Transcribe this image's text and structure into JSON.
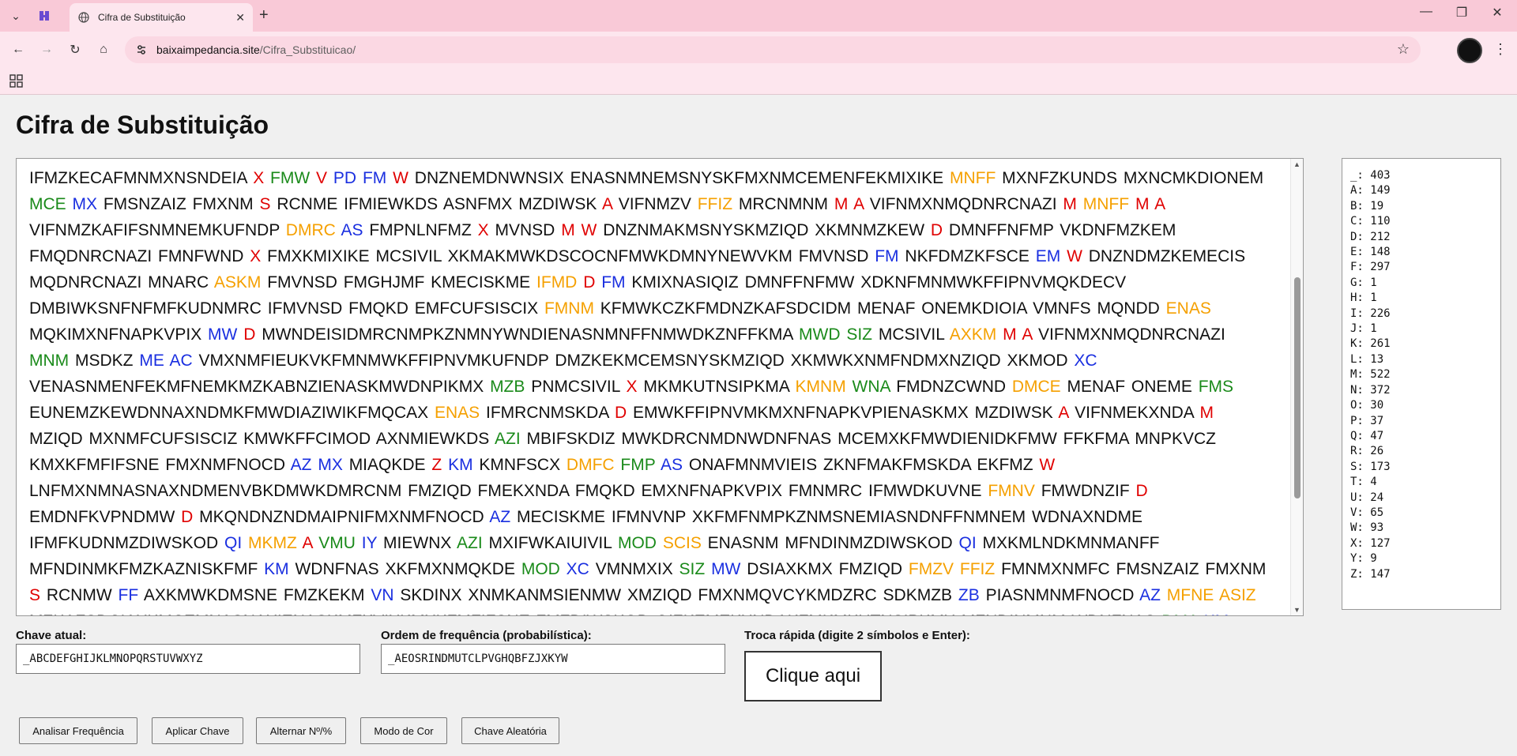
{
  "browser": {
    "tab_title": "Cifra de Substituição",
    "url_host": "baixaimpedancia.site",
    "url_path": "/Cifra_Substituicao/"
  },
  "page": {
    "title": "Cifra de Substituição"
  },
  "cipher_lines": [
    [
      [
        "n",
        "IFMZKECAFMNMXNSNDEIA "
      ],
      [
        "r",
        "X"
      ],
      [
        "n",
        " "
      ],
      [
        "g",
        "FMW"
      ],
      [
        "n",
        " "
      ],
      [
        "r",
        "V"
      ],
      [
        "n",
        " "
      ],
      [
        "b",
        "PD"
      ],
      [
        "n",
        " "
      ],
      [
        "b",
        "FM"
      ],
      [
        "n",
        " "
      ],
      [
        "r",
        "W"
      ],
      [
        "n",
        " DNZNEMDNWNSIX ENASNMNEMSNYSKFMXNMCEMENFEKMIXIKE "
      ],
      [
        "o",
        "MNFF"
      ],
      [
        "n",
        " MXNFZKUNDS MXNCMKDIONEM"
      ]
    ],
    [
      [
        "g",
        "MCE"
      ],
      [
        "n",
        " "
      ],
      [
        "b",
        "MX"
      ],
      [
        "n",
        " FMSNZAIZ FMXNM "
      ],
      [
        "r",
        "S"
      ],
      [
        "n",
        " RCNME IFMIEWKDS ASNFMX MZDIWSK "
      ],
      [
        "r",
        "A"
      ],
      [
        "n",
        " VIFNMZV "
      ],
      [
        "o",
        "FFIZ"
      ],
      [
        "n",
        " MRCNMNM "
      ],
      [
        "r",
        "M"
      ],
      [
        "n",
        " "
      ],
      [
        "r",
        "A"
      ],
      [
        "n",
        " VIFNMXNMQDNRCNAZI "
      ],
      [
        "r",
        "M"
      ],
      [
        "n",
        " "
      ],
      [
        "o",
        "MNFF"
      ],
      [
        "n",
        " "
      ],
      [
        "r",
        "M"
      ],
      [
        "n",
        " "
      ],
      [
        "r",
        "A"
      ]
    ],
    [
      [
        "n",
        "VIFNMZKAFIFSNMNEMKUFNDP "
      ],
      [
        "o",
        "DMRC"
      ],
      [
        "n",
        " "
      ],
      [
        "b",
        "AS"
      ],
      [
        "n",
        " FMPNLNFMZ "
      ],
      [
        "r",
        "X"
      ],
      [
        "n",
        " MVNSD "
      ],
      [
        "r",
        "M"
      ],
      [
        "n",
        " "
      ],
      [
        "r",
        "W"
      ],
      [
        "n",
        " DNZNMAKMSNYSKMZIQD XKMNMZKEW "
      ],
      [
        "r",
        "D"
      ],
      [
        "n",
        " DMNFFNFMP VKDNFMZKEM"
      ]
    ],
    [
      [
        "n",
        "FMQDNRCNAZI FMNFWND "
      ],
      [
        "r",
        "X"
      ],
      [
        "n",
        " FMXKMIXIKE MCSIVIL XKMAKMWKDSCOCNFMWKDMNYNEWVKM FMVNSD "
      ],
      [
        "b",
        "FM"
      ],
      [
        "n",
        " NKFDMZKFSCE "
      ],
      [
        "b",
        "EM"
      ],
      [
        "n",
        " "
      ],
      [
        "r",
        "W"
      ],
      [
        "n",
        " DNZNDMZKEMECIS"
      ]
    ],
    [
      [
        "n",
        "MQDNRCNAZI MNARC "
      ],
      [
        "o",
        "ASKM"
      ],
      [
        "n",
        " FMVNSD FMGHJMF KMECISKME "
      ],
      [
        "o",
        "IFMD"
      ],
      [
        "n",
        " "
      ],
      [
        "r",
        "D"
      ],
      [
        "n",
        " "
      ],
      [
        "b",
        "FM"
      ],
      [
        "n",
        " KMIXNASIQIZ DMNFFNFMW XDKNFMNMWKFFIPNVMQKDECV"
      ]
    ],
    [
      [
        "n",
        "DMBIWKSNFNFMFKUDNMRC IFMVNSD FMQKD EMFCUFSISCIX "
      ],
      [
        "o",
        "FMNM"
      ],
      [
        "n",
        " KFMWKCZKFMDNZKAFSDCIDM MENAF ONEMKDIOIA VMNFS MQNDD "
      ],
      [
        "o",
        "ENAS"
      ]
    ],
    [
      [
        "n",
        "MQKIMXNFNAPKVPIX "
      ],
      [
        "b",
        "MW"
      ],
      [
        "n",
        " "
      ],
      [
        "r",
        "D"
      ],
      [
        "n",
        " MWNDEISIDMRCNMPKZNMNYWNDIENASNMNFFNMWDKZNFFKMA "
      ],
      [
        "g",
        "MWD"
      ],
      [
        "n",
        " "
      ],
      [
        "g",
        "SIZ"
      ],
      [
        "n",
        " MCSIVIL "
      ],
      [
        "o",
        "AXKM"
      ],
      [
        "n",
        " "
      ],
      [
        "r",
        "M"
      ],
      [
        "n",
        " "
      ],
      [
        "r",
        "A"
      ],
      [
        "n",
        " VIFNMXNMQDNRCNAZI"
      ]
    ],
    [
      [
        "g",
        "MNM"
      ],
      [
        "n",
        " MSDKZ "
      ],
      [
        "b",
        "ME"
      ],
      [
        "n",
        " "
      ],
      [
        "b",
        "AC"
      ],
      [
        "n",
        " VMXNMFIEUKVKFMNMWKFFIPNVMKUFNDP DMZKEKMCEMSNYSKMZIQD XKMWKXNMFNDMXNZIQD XKMOD "
      ],
      [
        "b",
        "XC"
      ]
    ],
    [
      [
        "n",
        "VENASNMENFEKMFNEMKMZKABNZIENASKMWDNPIKMX "
      ],
      [
        "g",
        "MZB"
      ],
      [
        "n",
        " PNMCSIVIL "
      ],
      [
        "r",
        "X"
      ],
      [
        "n",
        " MKMKUTNSIPKMA "
      ],
      [
        "o",
        "KMNM"
      ],
      [
        "n",
        " "
      ],
      [
        "g",
        "WNA"
      ],
      [
        "n",
        " FMDNZCWND "
      ],
      [
        "o",
        "DMCE"
      ],
      [
        "n",
        " MENAF ONEME "
      ],
      [
        "g",
        "FMS"
      ]
    ],
    [
      [
        "n",
        "EUNEMZKEWDNNAXNDMKFMWDIAZIWIKFMQCAX "
      ],
      [
        "o",
        "ENAS"
      ],
      [
        "n",
        " IFMRCNMSKDA "
      ],
      [
        "r",
        "D"
      ],
      [
        "n",
        " EMWKFFIPNVMKMXNFNAPKVPIENASKMX MZDIWSK "
      ],
      [
        "r",
        "A"
      ],
      [
        "n",
        " VIFNMEKXNDA "
      ],
      [
        "r",
        "M"
      ]
    ],
    [
      [
        "n",
        "MZIQD MXNMFCUFSISCIZ KMWKFFCIMOD AXNMIEWKDS "
      ],
      [
        "g",
        "AZI"
      ],
      [
        "n",
        " MBIFSKDIZ MWKDRCNMDNWDNFNAS MCEMXKFMWDIENIDKFMW FFKFMA MNPKVCZ"
      ]
    ],
    [
      [
        "n",
        "KMXKFMFIFSNE FMXNMFNOCD "
      ],
      [
        "b",
        "AZ"
      ],
      [
        "n",
        " "
      ],
      [
        "b",
        "MX"
      ],
      [
        "n",
        " MIAQKDE "
      ],
      [
        "r",
        "Z"
      ],
      [
        "n",
        " "
      ],
      [
        "b",
        "KM"
      ],
      [
        "n",
        " KMNFSCX "
      ],
      [
        "o",
        "DMFC"
      ],
      [
        "n",
        " "
      ],
      [
        "g",
        "FMP"
      ],
      [
        "n",
        " "
      ],
      [
        "b",
        "AS"
      ],
      [
        "n",
        " ONAFMNMVIEIS ZKNFMAKFMSKDA EKFMZ "
      ],
      [
        "r",
        "W"
      ]
    ],
    [
      [
        "n",
        "LNFMXNMNASNAXNDMENVBKDMWKDMRCNM FMZIQD FMEKXNDA FMQKD EMXNFNAPKVPIX FMNMRC IFMWDKUVNE "
      ],
      [
        "o",
        "FMNV"
      ],
      [
        "n",
        " FMWDNZIF "
      ],
      [
        "r",
        "D"
      ]
    ],
    [
      [
        "n",
        "EMDNFKVPNDMW "
      ],
      [
        "r",
        "D"
      ],
      [
        "n",
        " MKQNDNZNDMAIPNIFMXNMFNOCD "
      ],
      [
        "b",
        "AZ"
      ],
      [
        "n",
        " MECISKME IFMNVNP XKFMFNMPKZNMSNEMIASNDNFFNMNEM WDNAXNDME"
      ]
    ],
    [
      [
        "n",
        "IFMFKUDNMZDIWSKOD "
      ],
      [
        "b",
        "QI"
      ],
      [
        "n",
        " "
      ],
      [
        "o",
        "MKMZ"
      ],
      [
        "n",
        " "
      ],
      [
        "r",
        "A"
      ],
      [
        "n",
        " "
      ],
      [
        "g",
        "VMU"
      ],
      [
        "n",
        " "
      ],
      [
        "b",
        "IY"
      ],
      [
        "n",
        " MIEWNX "
      ],
      [
        "g",
        "AZI"
      ],
      [
        "n",
        " MXIFWKAIUIVIL "
      ],
      [
        "g",
        "MOD"
      ],
      [
        "n",
        " "
      ],
      [
        "o",
        "SCIS"
      ],
      [
        "n",
        " ENASNM MFNDINMZDIWSKOD "
      ],
      [
        "b",
        "QI"
      ],
      [
        "n",
        " MXKMLNDKMNMANFF"
      ]
    ],
    [
      [
        "n",
        "MFNDINMKFMZKAZNISKFMF "
      ],
      [
        "b",
        "KM"
      ],
      [
        "n",
        " WDNFNAS XKFMXNMQKDE "
      ],
      [
        "g",
        "MOD"
      ],
      [
        "n",
        " "
      ],
      [
        "b",
        "XC"
      ],
      [
        "n",
        " VMNMXIX "
      ],
      [
        "g",
        "SIZ"
      ],
      [
        "n",
        " "
      ],
      [
        "b",
        "MW"
      ],
      [
        "n",
        " DSIAXKMX FMZIQD "
      ],
      [
        "o",
        "FMZV"
      ],
      [
        "n",
        " "
      ],
      [
        "o",
        "FFIZ"
      ],
      [
        "n",
        " FMNMXNMFC FMSNZAIZ FMXNM"
      ]
    ],
    [
      [
        "r",
        "S"
      ],
      [
        "n",
        " RCNMW "
      ],
      [
        "b",
        "FF"
      ],
      [
        "n",
        " AXKMWKDMSNE FMZKEKM "
      ],
      [
        "b",
        "VN"
      ],
      [
        "n",
        " SKDINX XNMKANMSIENMW XMZIQD FMXNMQVCYKMDZRC SDKMZB "
      ],
      [
        "b",
        "ZB"
      ],
      [
        "n",
        " PIASNMNMFNOCD "
      ],
      [
        "b",
        "AZ"
      ],
      [
        "n",
        " "
      ],
      [
        "o",
        "MFNE"
      ],
      [
        "n",
        " "
      ],
      [
        "o",
        "ASIZ"
      ]
    ],
    [
      [
        "n",
        "MZKAFSDCIAXKMCEMNASNAXIENASKMFKVIXKMXKFMFIFSNE FMZDIWSKOD QIZKEMEKXNDAKFMKMKUTNSIPKMX MFNDINMNM WDNFNAS "
      ],
      [
        "g",
        "DMA"
      ],
      [
        "n",
        " "
      ],
      [
        "b",
        "KM"
      ]
    ]
  ],
  "frequencies": [
    "_: 403",
    "A: 149",
    "B: 19",
    "C: 110",
    "D: 212",
    "E: 148",
    "F: 297",
    "G: 1",
    "H: 1",
    "I: 226",
    "J: 1",
    "K: 261",
    "L: 13",
    "M: 522",
    "N: 372",
    "O: 30",
    "P: 37",
    "Q: 47",
    "R: 26",
    "S: 173",
    "T: 4",
    "U: 24",
    "V: 65",
    "W: 93",
    "X: 127",
    "Y: 9",
    "Z: 147"
  ],
  "controls": {
    "current_key_label": "Chave atual:",
    "current_key_value": "_ABCDEFGHIJKLMNOPQRSTUVWXYZ",
    "freq_order_label": "Ordem de frequência (probabilística):",
    "freq_order_value": "_AEOSRINDMUTCLPVGHQBFZJXKYW",
    "quick_swap_label": "Troca rápida (digite 2 símbolos e Enter):",
    "quick_swap_button": "Clique aqui"
  },
  "actions": {
    "analyze": "Analisar Frequência",
    "apply": "Aplicar Chave",
    "toggle": "Alternar Nº/%",
    "color_mode": "Modo de Cor",
    "random_key": "Chave Aleatória"
  },
  "colors": {
    "red": "#e00000",
    "green": "#1a8a1a",
    "blue": "#1a2fe0",
    "orange": "#f5a000",
    "tab_bar": "#f9c9d7"
  }
}
